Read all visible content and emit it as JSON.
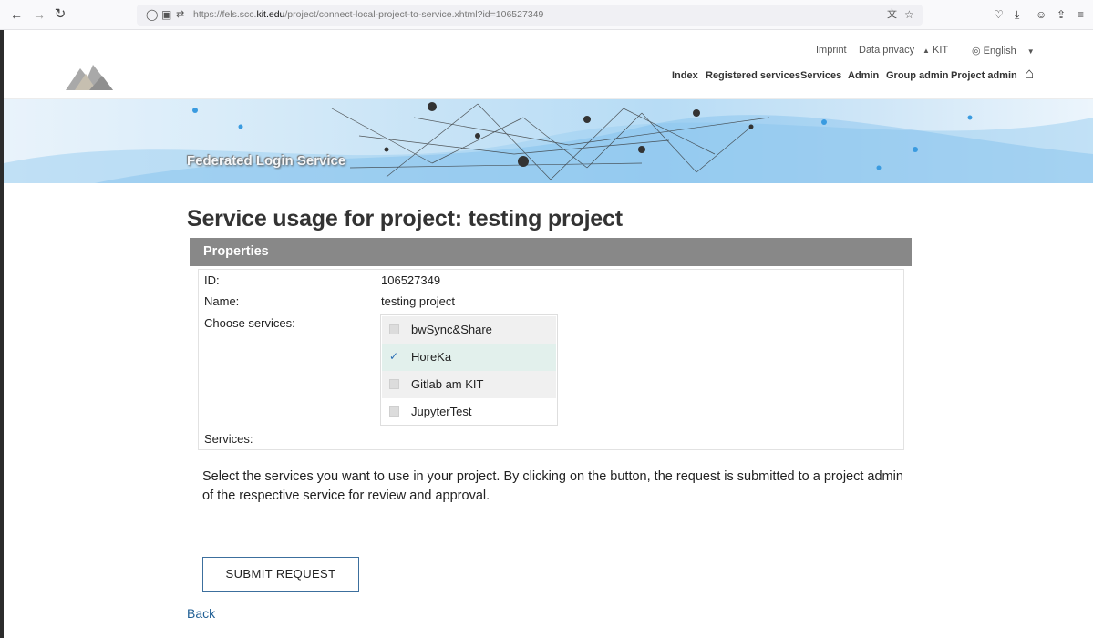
{
  "browser": {
    "url_prefix": "https://fels.scc.",
    "url_domain": "kit.edu",
    "url_path": "/project/connect-local-project-to-service.xhtml?id=106527349",
    "icons": [
      "back-icon",
      "forward-icon",
      "reload-icon",
      "shield-icon",
      "lock-icon",
      "permissions-icon",
      "translate-icon",
      "bookmark-star-icon",
      "pocket-icon",
      "download-icon",
      "account-icon",
      "extensions-icon",
      "menu-icon"
    ]
  },
  "header": {
    "top_links": {
      "imprint": "Imprint",
      "privacy": "Data privacy",
      "kit": "KIT",
      "language": "English"
    },
    "nav": {
      "index": "Index",
      "registered": "Registered services",
      "services": "Services",
      "admin": "Admin",
      "group_admin": "Group admin",
      "project_admin": "Project admin"
    }
  },
  "banner": {
    "title": "Federated Login Service"
  },
  "page": {
    "title": "Service usage for project: testing project",
    "panel_title": "Properties",
    "fields": {
      "id_label": "ID:",
      "id_value": "106527349",
      "name_label": "Name:",
      "name_value": "testing project",
      "choose_label": "Choose services:",
      "services_label": "Services:"
    },
    "services": [
      {
        "label": "bwSync&Share",
        "checked": false
      },
      {
        "label": "HoreKa",
        "checked": true
      },
      {
        "label": "Gitlab am KIT",
        "checked": false
      },
      {
        "label": "JupyterTest",
        "checked": false
      }
    ],
    "info": "Select the services you want to use in your project. By clicking on the button, the request is submitted to a project admin of the respective service for review and approval.",
    "submit": "SUBMIT REQUEST",
    "back": "Back"
  }
}
